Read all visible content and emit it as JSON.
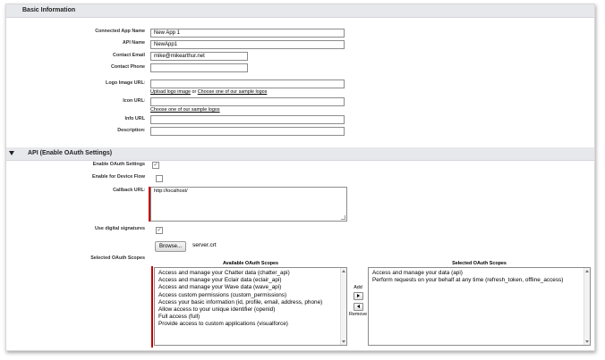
{
  "basic_info": {
    "header": "Basic Information",
    "connected_app_name_label": "Connected App Name",
    "connected_app_name_value": "New App 1",
    "api_name_label": "API Name",
    "api_name_value": "NewApp1",
    "contact_email_label": "Contact Email",
    "contact_email_value": "mike@mikearthur.net",
    "contact_phone_label": "Contact Phone",
    "contact_phone_value": "",
    "logo_image_url_label": "Logo Image URL",
    "logo_upload_link": "Upload logo image",
    "logo_or_text": " or ",
    "logo_sample_link": "Choose one of our sample logos",
    "icon_url_label": "Icon URL",
    "icon_sample_link": "Choose one of our sample logos",
    "info_url_label": "Info URL",
    "description_label": "Description",
    "help_icon": "i"
  },
  "api_section": {
    "header": "API (Enable OAuth Settings)",
    "enable_oauth_label": "Enable OAuth Settings",
    "enable_oauth_checked": true,
    "enable_device_flow_label": "Enable for Device Flow",
    "enable_device_flow_checked": false,
    "callback_url_label": "Callback URL",
    "callback_url_value": "http://localhost/",
    "use_digital_signatures_label": "Use digital signatures",
    "use_digital_signatures_checked": true,
    "browse_label": "Browse...",
    "file_name": "server.crt",
    "selected_scopes_label": "Selected OAuth Scopes",
    "available_scopes_title": "Available OAuth Scopes",
    "selected_scopes_title": "Selected OAuth Scopes",
    "available_scopes": [
      "Access and manage your Chatter data (chatter_api)",
      "Access and manage your Eclair data (eclair_api)",
      "Access and manage your Wave data (wave_api)",
      "Access custom permissions (custom_permissions)",
      "Access your basic information (id, profile, email, address, phone)",
      "Allow access to your unique identifier (openid)",
      "Full access (full)",
      "Provide access to custom applications (visualforce)"
    ],
    "selected_scopes": [
      "Access and manage your data (api)",
      "Perform requests on your behalf at any time (refresh_token, offline_access)"
    ],
    "add_label": "Add",
    "remove_label": "Remove"
  },
  "colors": {
    "required": "#c00000",
    "header_bg": "#e7e8ec"
  }
}
